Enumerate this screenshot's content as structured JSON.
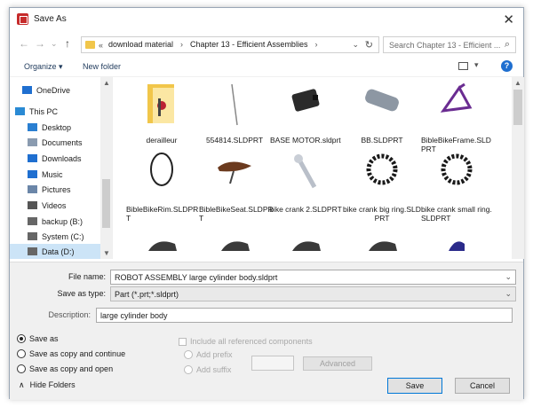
{
  "window": {
    "title": "Save As",
    "close_label": "✕"
  },
  "nav": {
    "back": "←",
    "forward": "→",
    "recent": "⌄",
    "up": "↑",
    "path_prefix": "«",
    "crumbs": [
      "download material",
      "Chapter 13 - Efficient Assemblies"
    ],
    "crumb_sep": "›",
    "search_placeholder": "Search Chapter 13 - Efficient ...",
    "search_icon": "⌕"
  },
  "toolbar": {
    "organize": "Organize ▾",
    "new_folder": "New folder",
    "help": "?"
  },
  "sidebar": {
    "items": [
      {
        "label": "OneDrive",
        "icon": "cloud-icon",
        "color": "#1f6fd0"
      },
      {
        "label": "This PC",
        "icon": "computer-icon",
        "color": "#2a8ad4"
      },
      {
        "label": "Desktop",
        "icon": "desktop-icon",
        "color": "#2a7fd1"
      },
      {
        "label": "Documents",
        "icon": "documents-icon",
        "color": "#8a9bb0"
      },
      {
        "label": "Downloads",
        "icon": "downloads-icon",
        "color": "#1f6fd0"
      },
      {
        "label": "Music",
        "icon": "music-icon",
        "color": "#1f6fd0"
      },
      {
        "label": "Pictures",
        "icon": "pictures-icon",
        "color": "#6b86a8"
      },
      {
        "label": "Videos",
        "icon": "videos-icon",
        "color": "#555555"
      },
      {
        "label": "backup (B:)",
        "icon": "drive-icon",
        "color": "#666666"
      },
      {
        "label": "System (C:)",
        "icon": "drive-icon",
        "color": "#666666"
      },
      {
        "label": "Data (D:)",
        "icon": "drive-icon",
        "color": "#666666"
      }
    ]
  },
  "files": [
    {
      "label": "derailleur",
      "kind": "folder"
    },
    {
      "label": "554814.SLDPRT",
      "kind": "rod"
    },
    {
      "label": "BASE MOTOR.sldprt",
      "kind": "motor"
    },
    {
      "label": "BB.SLDPRT",
      "kind": "cylinder"
    },
    {
      "label": "BibleBikeFrame.SLDPRT",
      "kind": "frame"
    },
    {
      "label": "BibleBikeRim.SLDPRT",
      "kind": "rim"
    },
    {
      "label": "BibleBikeSeat.SLDPRT",
      "kind": "seat"
    },
    {
      "label": "bike crank 2.SLDPRT",
      "kind": "crank"
    },
    {
      "label": "bike crank big ring.SLDPRT",
      "kind": "gear"
    },
    {
      "label": "bike crank small ring.SLDPRT",
      "kind": "gear"
    },
    {
      "label": "",
      "kind": "partial-dark"
    },
    {
      "label": "",
      "kind": "partial-dark"
    },
    {
      "label": "",
      "kind": "partial-dark"
    },
    {
      "label": "",
      "kind": "partial-dark"
    },
    {
      "label": "",
      "kind": "partial-blue"
    }
  ],
  "form": {
    "file_name_label": "File name:",
    "file_name_value": "ROBOT ASSEMBLY large cylinder body.sldprt",
    "save_type_label": "Save as type:",
    "save_type_value": "Part (*.prt;*.sldprt)",
    "description_label": "Description:",
    "description_value": "large cylinder body",
    "dropdown_arrow": "⌄"
  },
  "options": {
    "save_as": "Save as",
    "save_copy_continue": "Save as copy and continue",
    "save_copy_open": "Save as copy and open",
    "include_refs": "Include all referenced components",
    "add_prefix": "Add prefix",
    "add_suffix": "Add suffix",
    "advanced": "Advanced"
  },
  "buttons": {
    "save": "Save",
    "cancel": "Cancel",
    "hide_folders": "Hide Folders",
    "hide_arrow": "∧"
  }
}
